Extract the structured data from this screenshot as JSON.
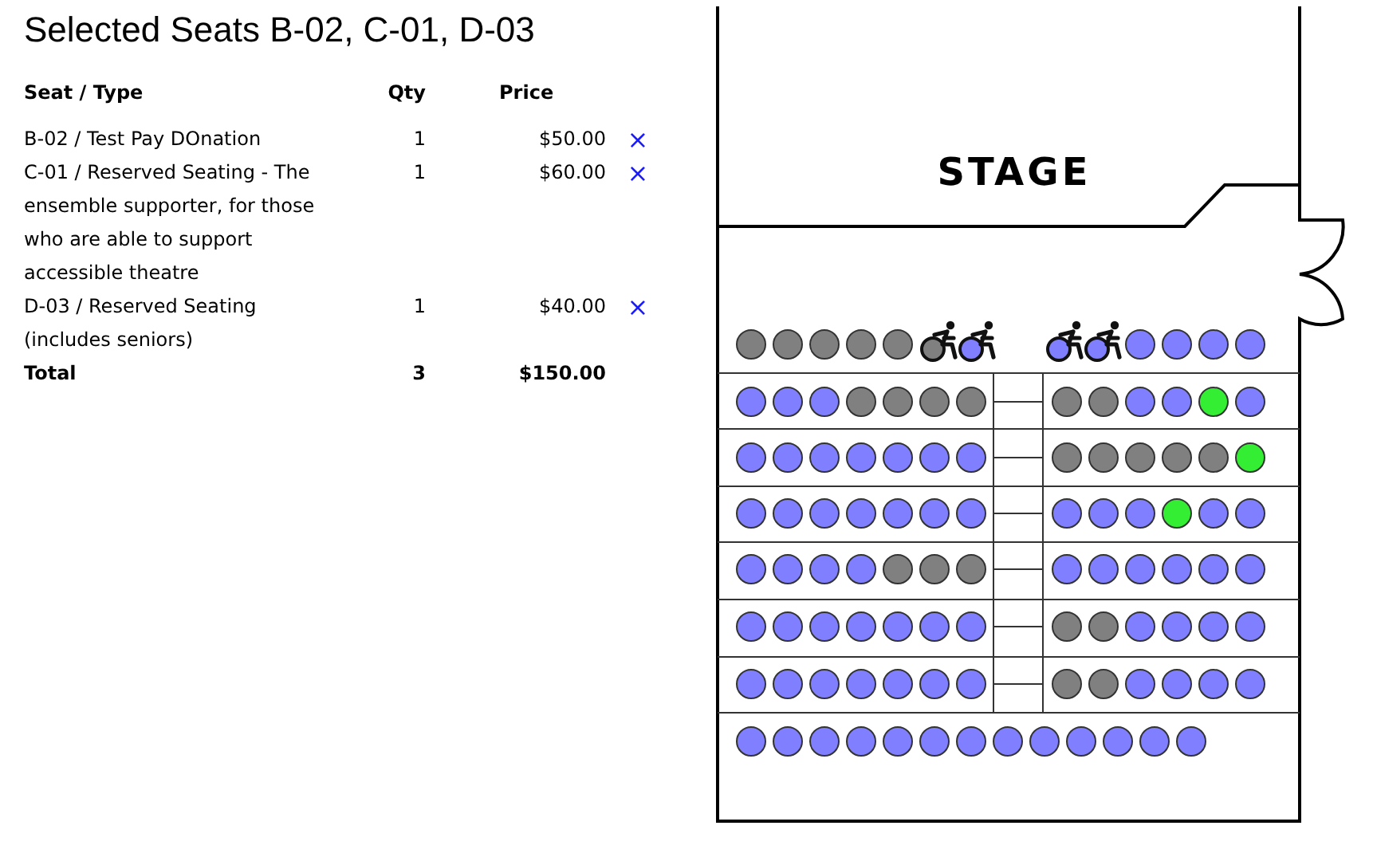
{
  "title": "Selected Seats B-02, C-01, D-03",
  "table": {
    "columns": [
      "Seat / Type",
      "Qty",
      "Price"
    ],
    "rows": [
      {
        "seat_type": "B-02 / Test Pay DOnation",
        "qty": "1",
        "price": "$50.00",
        "remove": "×"
      },
      {
        "seat_type": "C-01 / Reserved Seating - The ensemble supporter, for those who are able to support accessible theatre",
        "qty": "1",
        "price": "$60.00",
        "remove": "×"
      },
      {
        "seat_type": "D-03 / Reserved Seating (includes seniors)",
        "qty": "1",
        "price": "$40.00",
        "remove": "×"
      }
    ],
    "total": {
      "label": "Total",
      "qty": "3",
      "price": "$150.00"
    }
  },
  "seat_map": {
    "stage_label": "STAGE",
    "front_row": [
      {
        "kind": "standard",
        "color": "#808080"
      },
      {
        "kind": "standard",
        "color": "#808080"
      },
      {
        "kind": "standard",
        "color": "#808080"
      },
      {
        "kind": "standard",
        "color": "#808080"
      },
      {
        "kind": "standard",
        "color": "#808080"
      },
      {
        "kind": "wheelchair",
        "color": "#808080"
      },
      {
        "kind": "wheelchair",
        "color": "#7f7fff"
      },
      {
        "kind": "wheelchair",
        "color": "#7f7fff"
      },
      {
        "kind": "wheelchair",
        "color": "#7f7fff"
      },
      {
        "kind": "standard",
        "color": "#7f7fff"
      },
      {
        "kind": "standard",
        "color": "#7f7fff"
      },
      {
        "kind": "standard",
        "color": "#7f7fff"
      },
      {
        "kind": "standard",
        "color": "#7f7fff"
      }
    ],
    "rows": [
      {
        "left": [
          {
            "color": "#7f7fff"
          },
          {
            "color": "#7f7fff"
          },
          {
            "color": "#7f7fff"
          },
          {
            "color": "#808080"
          },
          {
            "color": "#808080"
          },
          {
            "color": "#808080"
          },
          {
            "color": "#808080"
          }
        ],
        "right": [
          {
            "color": "#808080"
          },
          {
            "color": "#808080"
          },
          {
            "color": "#7f7fff"
          },
          {
            "color": "#7f7fff"
          },
          {
            "color": "#33ee33"
          },
          {
            "color": "#7f7fff"
          }
        ]
      },
      {
        "left": [
          {
            "color": "#7f7fff"
          },
          {
            "color": "#7f7fff"
          },
          {
            "color": "#7f7fff"
          },
          {
            "color": "#7f7fff"
          },
          {
            "color": "#7f7fff"
          },
          {
            "color": "#7f7fff"
          },
          {
            "color": "#7f7fff"
          }
        ],
        "right": [
          {
            "color": "#808080"
          },
          {
            "color": "#808080"
          },
          {
            "color": "#808080"
          },
          {
            "color": "#808080"
          },
          {
            "color": "#808080"
          },
          {
            "color": "#33ee33"
          }
        ]
      },
      {
        "left": [
          {
            "color": "#7f7fff"
          },
          {
            "color": "#7f7fff"
          },
          {
            "color": "#7f7fff"
          },
          {
            "color": "#7f7fff"
          },
          {
            "color": "#7f7fff"
          },
          {
            "color": "#7f7fff"
          },
          {
            "color": "#7f7fff"
          }
        ],
        "right": [
          {
            "color": "#7f7fff"
          },
          {
            "color": "#7f7fff"
          },
          {
            "color": "#7f7fff"
          },
          {
            "color": "#33ee33"
          },
          {
            "color": "#7f7fff"
          },
          {
            "color": "#7f7fff"
          }
        ]
      },
      {
        "left": [
          {
            "color": "#7f7fff"
          },
          {
            "color": "#7f7fff"
          },
          {
            "color": "#7f7fff"
          },
          {
            "color": "#7f7fff"
          },
          {
            "color": "#808080"
          },
          {
            "color": "#808080"
          },
          {
            "color": "#808080"
          }
        ],
        "right": [
          {
            "color": "#7f7fff"
          },
          {
            "color": "#7f7fff"
          },
          {
            "color": "#7f7fff"
          },
          {
            "color": "#7f7fff"
          },
          {
            "color": "#7f7fff"
          },
          {
            "color": "#7f7fff"
          }
        ]
      },
      {
        "left": [
          {
            "color": "#7f7fff"
          },
          {
            "color": "#7f7fff"
          },
          {
            "color": "#7f7fff"
          },
          {
            "color": "#7f7fff"
          },
          {
            "color": "#7f7fff"
          },
          {
            "color": "#7f7fff"
          },
          {
            "color": "#7f7fff"
          }
        ],
        "right": [
          {
            "color": "#808080"
          },
          {
            "color": "#808080"
          },
          {
            "color": "#7f7fff"
          },
          {
            "color": "#7f7fff"
          },
          {
            "color": "#7f7fff"
          },
          {
            "color": "#7f7fff"
          }
        ]
      },
      {
        "left": [
          {
            "color": "#7f7fff"
          },
          {
            "color": "#7f7fff"
          },
          {
            "color": "#7f7fff"
          },
          {
            "color": "#7f7fff"
          },
          {
            "color": "#7f7fff"
          },
          {
            "color": "#7f7fff"
          },
          {
            "color": "#7f7fff"
          }
        ],
        "right": [
          {
            "color": "#808080"
          },
          {
            "color": "#808080"
          },
          {
            "color": "#7f7fff"
          },
          {
            "color": "#7f7fff"
          },
          {
            "color": "#7f7fff"
          },
          {
            "color": "#7f7fff"
          }
        ]
      }
    ],
    "back_row": [
      {
        "color": "#7f7fff"
      },
      {
        "color": "#7f7fff"
      },
      {
        "color": "#7f7fff"
      },
      {
        "color": "#7f7fff"
      },
      {
        "color": "#7f7fff"
      },
      {
        "color": "#7f7fff"
      },
      {
        "color": "#7f7fff"
      },
      {
        "color": "#7f7fff"
      },
      {
        "color": "#7f7fff"
      },
      {
        "color": "#7f7fff"
      },
      {
        "color": "#7f7fff"
      },
      {
        "color": "#7f7fff"
      },
      {
        "color": "#7f7fff"
      }
    ]
  }
}
